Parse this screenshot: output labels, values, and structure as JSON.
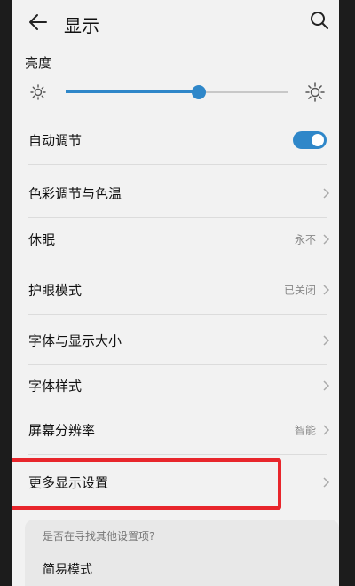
{
  "header": {
    "title": "显示",
    "back_icon": "back-arrow-icon",
    "search_icon": "search-icon"
  },
  "brightness": {
    "label": "亮度",
    "level_fraction": 0.6,
    "accent_color": "#2f87c9"
  },
  "settings": {
    "auto_adjust": {
      "label": "自动调节",
      "enabled": true
    },
    "color_temp": {
      "label": "色彩调节与色温"
    },
    "sleep": {
      "label": "休眠",
      "value": "永不"
    },
    "eye_comfort": {
      "label": "护眼模式",
      "value": "已关闭"
    },
    "font_size": {
      "label": "字体与显示大小"
    },
    "font_style": {
      "label": "字体样式"
    },
    "resolution": {
      "label": "屏幕分辨率",
      "value": "智能"
    },
    "more_display": {
      "label": "更多显示设置"
    }
  },
  "suggestions": {
    "title": "是否在寻找其他设置项?",
    "items": [
      "简易模式"
    ]
  },
  "highlight_color": "#e8262c"
}
